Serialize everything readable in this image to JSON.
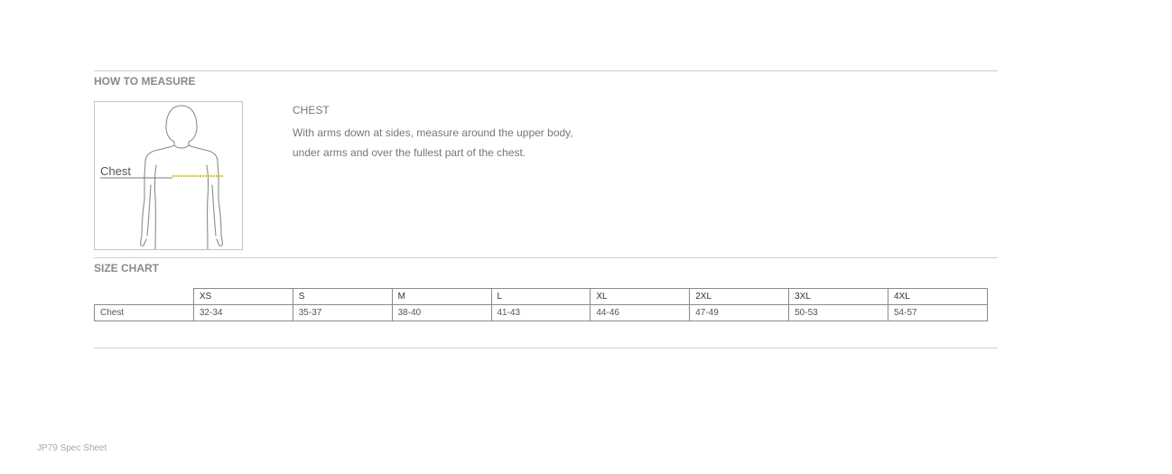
{
  "how_to_measure": {
    "title": "HOW TO MEASURE",
    "figure_label": "Chest",
    "heading": "CHEST",
    "description": "With arms down at sides, measure around the upper body, under arms and over the fullest part of the chest."
  },
  "size_chart": {
    "title": "SIZE CHART",
    "sizes": [
      "XS",
      "S",
      "M",
      "L",
      "XL",
      "2XL",
      "3XL",
      "4XL"
    ],
    "rows": [
      {
        "label": "Chest",
        "values": [
          "32-34",
          "35-37",
          "38-40",
          "41-43",
          "44-46",
          "47-49",
          "50-53",
          "54-57"
        ]
      }
    ]
  },
  "footer": {
    "text": "JP79 Spec Sheet"
  },
  "colors": {
    "rule": "#cfcfcf",
    "text": "#777777",
    "measure_line": "#d6c418"
  }
}
